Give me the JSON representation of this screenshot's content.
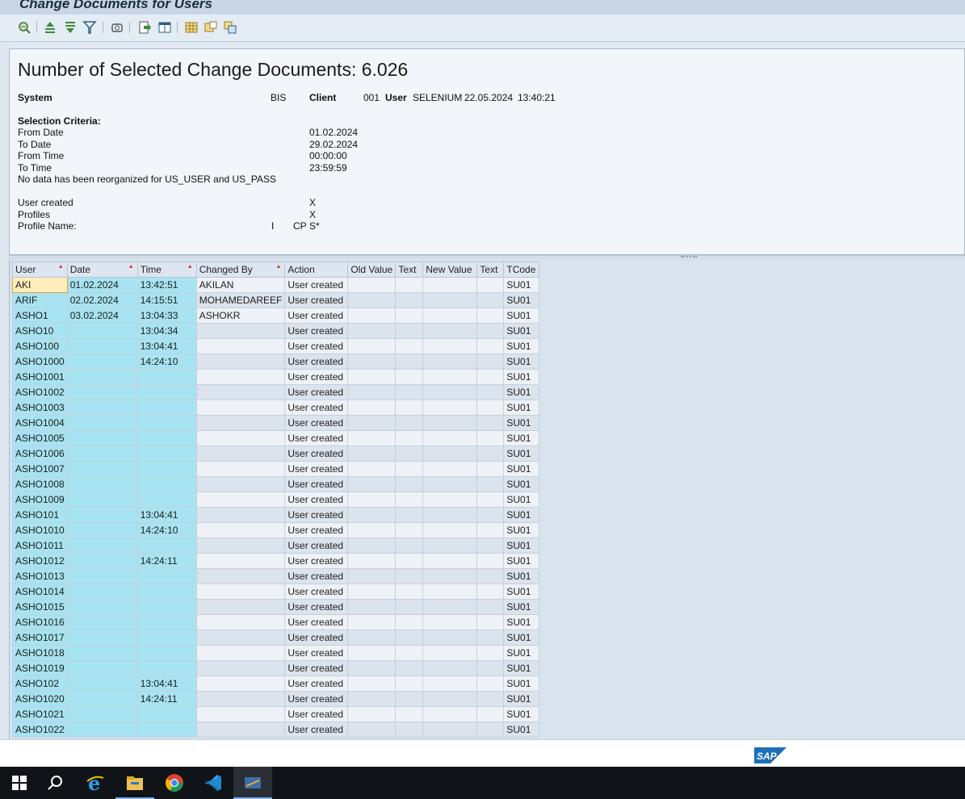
{
  "window": {
    "title": "Change Documents for Users"
  },
  "header": {
    "heading": "Number of Selected Change Documents: 6.026",
    "system_label": "System",
    "system_value": "BIS",
    "client_label": "Client",
    "client_value": "001",
    "user_label": "User",
    "user_value": "SELENIUM",
    "date_value": "22.05.2024",
    "time_value": "13:40:21",
    "selection_title": "Selection Criteria:",
    "from_date_label": "From Date",
    "from_date_value": "01.02.2024",
    "to_date_label": "To Date",
    "to_date_value": "29.02.2024",
    "from_time_label": "From Time",
    "from_time_value": "00:00:00",
    "to_time_label": "To Time",
    "to_time_value": "23:59:59",
    "reorg_note": "No data has been reorganized for US_USER and US_PASS",
    "user_created_label": "User created",
    "user_created_value": "X",
    "profiles_label": "Profiles",
    "profiles_value": "X",
    "profile_name_label": "Profile Name:",
    "profile_name_opt1": "I",
    "profile_name_opt2": "CP",
    "profile_name_value": "S*"
  },
  "toolbar": {
    "icons": [
      "details-icon",
      "sort-ascending-icon",
      "sort-descending-icon",
      "filter-icon",
      "print-preview-icon",
      "export-icon",
      "layout-icon",
      "grid-layout-icon",
      "columns-icon",
      "abc-analysis-icon"
    ]
  },
  "grid": {
    "columns": [
      "User",
      "Date",
      "Time",
      "Changed By",
      "Action",
      "Old Value",
      "Text",
      "New Value",
      "Text",
      "TCode"
    ],
    "rows": [
      [
        "AKI",
        "01.02.2024",
        "13:42:51",
        "AKILAN",
        "User created",
        "",
        "",
        "",
        "",
        "SU01"
      ],
      [
        "ARIF",
        "02.02.2024",
        "14:15:51",
        "MOHAMEDAREEF",
        "User created",
        "",
        "",
        "",
        "",
        "SU01"
      ],
      [
        "ASHO1",
        "03.02.2024",
        "13:04:33",
        "ASHOKR",
        "User created",
        "",
        "",
        "",
        "",
        "SU01"
      ],
      [
        "ASHO10",
        "",
        "13:04:34",
        "",
        "User created",
        "",
        "",
        "",
        "",
        "SU01"
      ],
      [
        "ASHO100",
        "",
        "13:04:41",
        "",
        "User created",
        "",
        "",
        "",
        "",
        "SU01"
      ],
      [
        "ASHO1000",
        "",
        "14:24:10",
        "",
        "User created",
        "",
        "",
        "",
        "",
        "SU01"
      ],
      [
        "ASHO1001",
        "",
        "",
        "",
        "User created",
        "",
        "",
        "",
        "",
        "SU01"
      ],
      [
        "ASHO1002",
        "",
        "",
        "",
        "User created",
        "",
        "",
        "",
        "",
        "SU01"
      ],
      [
        "ASHO1003",
        "",
        "",
        "",
        "User created",
        "",
        "",
        "",
        "",
        "SU01"
      ],
      [
        "ASHO1004",
        "",
        "",
        "",
        "User created",
        "",
        "",
        "",
        "",
        "SU01"
      ],
      [
        "ASHO1005",
        "",
        "",
        "",
        "User created",
        "",
        "",
        "",
        "",
        "SU01"
      ],
      [
        "ASHO1006",
        "",
        "",
        "",
        "User created",
        "",
        "",
        "",
        "",
        "SU01"
      ],
      [
        "ASHO1007",
        "",
        "",
        "",
        "User created",
        "",
        "",
        "",
        "",
        "SU01"
      ],
      [
        "ASHO1008",
        "",
        "",
        "",
        "User created",
        "",
        "",
        "",
        "",
        "SU01"
      ],
      [
        "ASHO1009",
        "",
        "",
        "",
        "User created",
        "",
        "",
        "",
        "",
        "SU01"
      ],
      [
        "ASHO101",
        "",
        "13:04:41",
        "",
        "User created",
        "",
        "",
        "",
        "",
        "SU01"
      ],
      [
        "ASHO1010",
        "",
        "14:24:10",
        "",
        "User created",
        "",
        "",
        "",
        "",
        "SU01"
      ],
      [
        "ASHO1011",
        "",
        "",
        "",
        "User created",
        "",
        "",
        "",
        "",
        "SU01"
      ],
      [
        "ASHO1012",
        "",
        "14:24:11",
        "",
        "User created",
        "",
        "",
        "",
        "",
        "SU01"
      ],
      [
        "ASHO1013",
        "",
        "",
        "",
        "User created",
        "",
        "",
        "",
        "",
        "SU01"
      ],
      [
        "ASHO1014",
        "",
        "",
        "",
        "User created",
        "",
        "",
        "",
        "",
        "SU01"
      ],
      [
        "ASHO1015",
        "",
        "",
        "",
        "User created",
        "",
        "",
        "",
        "",
        "SU01"
      ],
      [
        "ASHO1016",
        "",
        "",
        "",
        "User created",
        "",
        "",
        "",
        "",
        "SU01"
      ],
      [
        "ASHO1017",
        "",
        "",
        "",
        "User created",
        "",
        "",
        "",
        "",
        "SU01"
      ],
      [
        "ASHO1018",
        "",
        "",
        "",
        "User created",
        "",
        "",
        "",
        "",
        "SU01"
      ],
      [
        "ASHO1019",
        "",
        "",
        "",
        "User created",
        "",
        "",
        "",
        "",
        "SU01"
      ],
      [
        "ASHO102",
        "",
        "13:04:41",
        "",
        "User created",
        "",
        "",
        "",
        "",
        "SU01"
      ],
      [
        "ASHO1020",
        "",
        "14:24:11",
        "",
        "User created",
        "",
        "",
        "",
        "",
        "SU01"
      ],
      [
        "ASHO1021",
        "",
        "",
        "",
        "User created",
        "",
        "",
        "",
        "",
        "SU01"
      ],
      [
        "ASHO1022",
        "",
        "",
        "",
        "User created",
        "",
        "",
        "",
        "",
        "SU01"
      ]
    ]
  },
  "footer": {
    "brand": "SAP"
  },
  "taskbar": {
    "items": [
      "start-icon",
      "search-icon",
      "internet-explorer-icon",
      "file-explorer-icon",
      "chrome-icon",
      "vscode-icon",
      "sap-logon-icon"
    ]
  },
  "colors": {
    "key_column_bg": "#a7e3f0",
    "selected_cell_bg": "#ffeebb",
    "sap_blue": "#1d6fb8"
  }
}
